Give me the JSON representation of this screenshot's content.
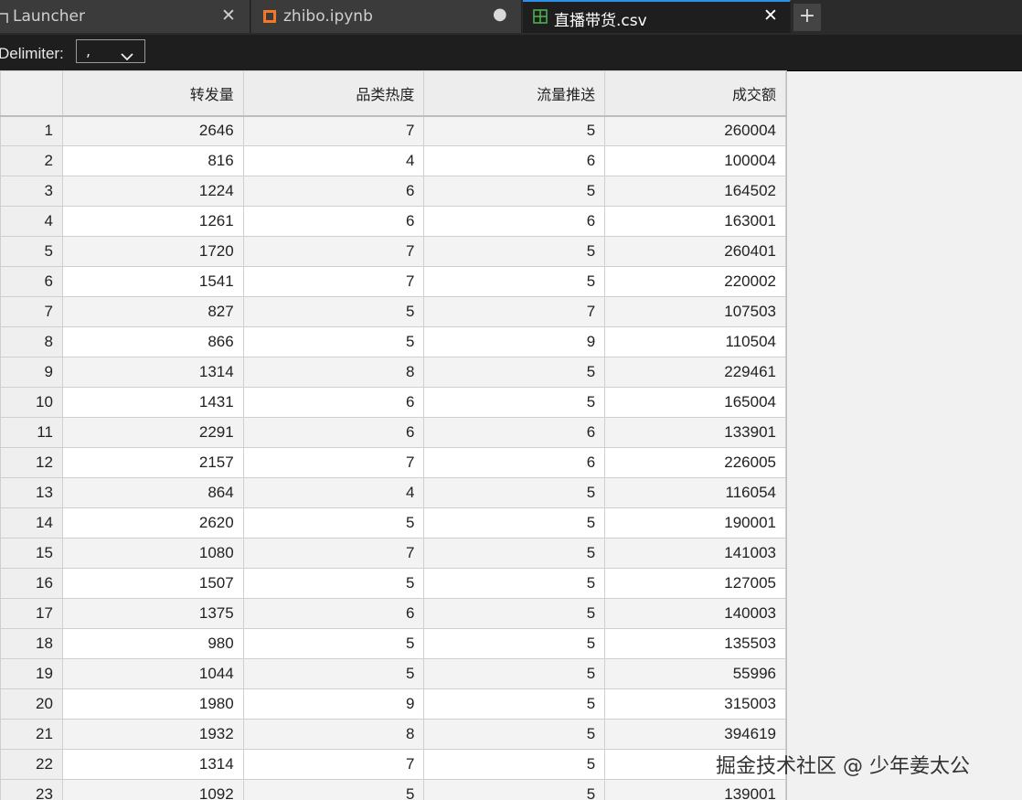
{
  "tabs": [
    {
      "label": "Launcher",
      "close": "✕"
    },
    {
      "label": "zhibo.ipynb",
      "modified": "●"
    },
    {
      "label": "直播带货.csv",
      "close": "✕"
    }
  ],
  "new_tab": "+",
  "toolbar": {
    "delimiter_label": "Delimiter:",
    "delimiter_value": ","
  },
  "table": {
    "columns": [
      "转发量",
      "品类热度",
      "流量推送",
      "成交额"
    ],
    "rows": [
      [
        1,
        2646,
        7,
        5,
        260004
      ],
      [
        2,
        816,
        4,
        6,
        100004
      ],
      [
        3,
        1224,
        6,
        5,
        164502
      ],
      [
        4,
        1261,
        6,
        6,
        163001
      ],
      [
        5,
        1720,
        7,
        5,
        260401
      ],
      [
        6,
        1541,
        7,
        5,
        220002
      ],
      [
        7,
        827,
        5,
        7,
        107503
      ],
      [
        8,
        866,
        5,
        9,
        110504
      ],
      [
        9,
        1314,
        8,
        5,
        229461
      ],
      [
        10,
        1431,
        6,
        5,
        165004
      ],
      [
        11,
        2291,
        6,
        6,
        133901
      ],
      [
        12,
        2157,
        7,
        6,
        226005
      ],
      [
        13,
        864,
        4,
        5,
        116054
      ],
      [
        14,
        2620,
        5,
        5,
        190001
      ],
      [
        15,
        1080,
        7,
        5,
        141003
      ],
      [
        16,
        1507,
        5,
        5,
        127005
      ],
      [
        17,
        1375,
        6,
        5,
        140003
      ],
      [
        18,
        980,
        5,
        5,
        135503
      ],
      [
        19,
        1044,
        5,
        5,
        55996
      ],
      [
        20,
        1980,
        9,
        5,
        315003
      ],
      [
        21,
        1932,
        8,
        5,
        394619
      ],
      [
        22,
        1314,
        7,
        5,
        ""
      ],
      [
        23,
        1092,
        5,
        5,
        139001
      ]
    ]
  },
  "watermark": "掘金技术社区 @ 少年姜太公",
  "colors": {
    "accent": "#2e8ee5",
    "notebook_icon": "#f37726",
    "csv_icon": "#4caf50"
  }
}
